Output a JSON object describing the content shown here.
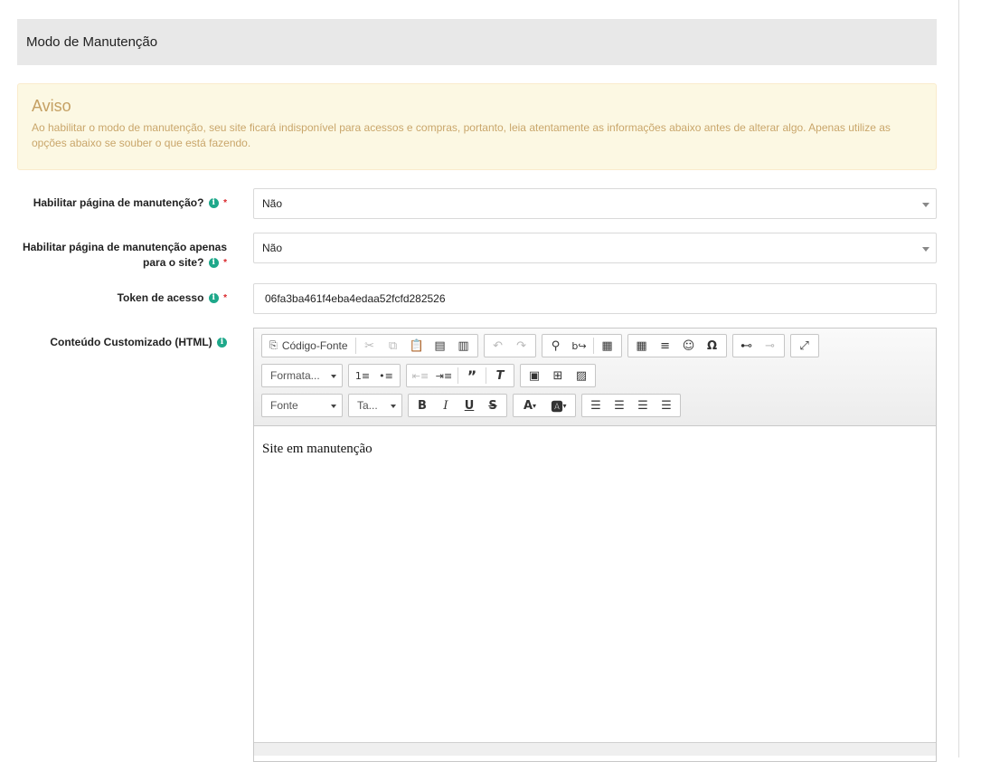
{
  "page": {
    "title": "Modo de Manutenção"
  },
  "alert": {
    "title": "Aviso",
    "text": "Ao habilitar o modo de manutenção, seu site ficará indisponível para acessos e compras, portanto, leia atentamente as informações abaixo antes de alterar algo. Apenas utilize as opções abaixo se souber o que está fazendo."
  },
  "form": {
    "info_glyph": "i",
    "required_mark": "*",
    "maintenance_page": {
      "label": "Habilitar página de manutenção?",
      "value": "Não"
    },
    "maintenance_site_only": {
      "label_line1": "Habilitar página de manutenção apenas",
      "label_line2": "para o site?",
      "value": "Não"
    },
    "token": {
      "label": "Token de acesso",
      "value": "06fa3ba461f4eba4edaa52fcfd282526"
    },
    "custom_content": {
      "label": "Conteúdo Customizado (HTML)"
    }
  },
  "editor": {
    "source_label": "Código-Fonte",
    "format_label": "Formata...",
    "font_label": "Fonte",
    "size_label": "Ta...",
    "content": "Site em manutenção",
    "icons": {
      "source": "source-icon",
      "cut": "cut-icon",
      "copy": "copy-icon",
      "paste": "paste-icon",
      "paste_text": "paste-text-icon",
      "paste_word": "paste-word-icon",
      "undo": "undo-icon",
      "redo": "redo-icon",
      "find": "find-icon",
      "replace": "replace-icon",
      "select_all": "select-all-icon",
      "table": "table-icon",
      "horizontal_rule": "horizontal-rule-icon",
      "smiley": "smiley-icon",
      "special_char": "special-char-icon",
      "link": "link-icon",
      "unlink": "unlink-icon",
      "maximize": "maximize-icon"
    }
  },
  "colors": {
    "accent_info": "#1ea88a",
    "required": "#d9262a",
    "warning_bg": "#fcf8e3",
    "warning_text": "#c09853"
  }
}
